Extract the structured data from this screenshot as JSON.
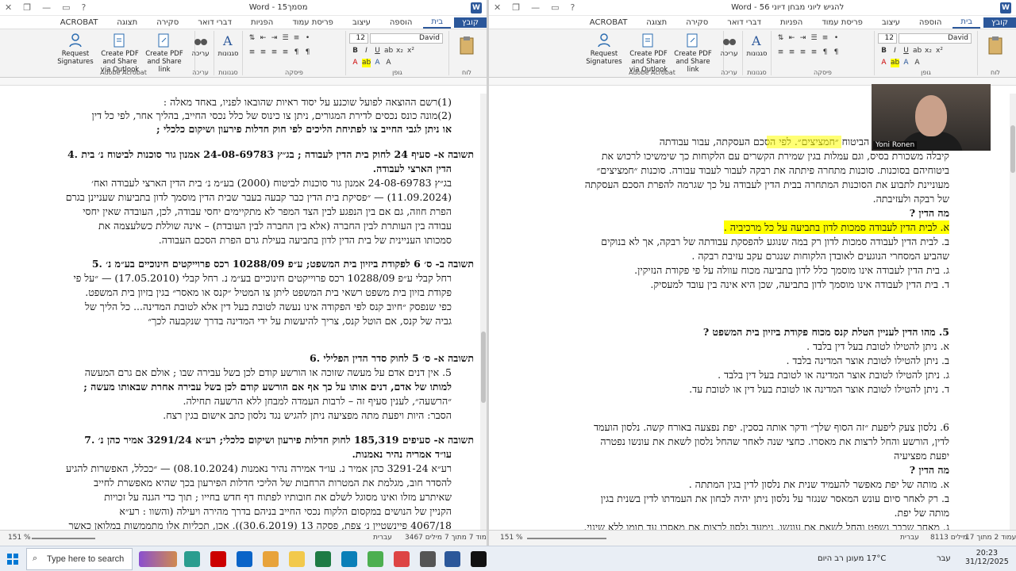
{
  "left_window": {
    "title": "מסמך15 - Word",
    "tabs": [
      "קובץ",
      "בית",
      "הוספה",
      "עיצוב",
      "פריסת עמוד",
      "הפניות",
      "דברי דואר",
      "סקירה",
      "תצוגה",
      "ACROBAT"
    ],
    "ribbon": {
      "acrobat_buttons": [
        "Request Signatures",
        "Create PDF and Share via Outlook",
        "Create PDF and Share link"
      ],
      "group_labels": [
        "Adobe Acrobat",
        "עריכה",
        "סגנונות",
        "פיסקה",
        "גופן",
        "לוח"
      ],
      "style_label": "סגנונות",
      "edit_label": "עריכה",
      "font_name": "David",
      "font_size": "12"
    },
    "body": [
      {
        "text": "(1)רשם ההוצאה לפועל שוכנע על יסוד ראיות שהובאו לפניו, באחד מאלה :",
        "bold": false
      },
      {
        "text": "(2)מונה כונס נכסים לדירת המגורים, ניתן צו כינוס של כלל נכסי החייב, בהליך אחר, לפי כל דין",
        "bold": false
      },
      {
        "text": "או ניתן לגבי החייב צו לפתיחת הליכים לפי חוק חדלות פירעון ושיקום כלכלי ;",
        "bold": true
      },
      {
        "text": "",
        "bold": false
      },
      {
        "text": "תשובה א- סעיף 24 לחוק בית הדין לעבודה ; בג״ץ 24-08-69783 אמנון גור סוכנות לביטוח נ׳ בית  .4",
        "bold": true
      },
      {
        "text": "הדין הארצי לעבודה.",
        "bold": true
      },
      {
        "text": "בג״ץ 24-08-69783 אמנון גור סוכנות לביטוח (2000) בע״מ נ׳ בית הדין הארצי לעבודה ואח׳",
        "bold": false
      },
      {
        "text": "(11.09.2024) — ״פסיקת בית הדין כבר קבעה בעבר שבית הדין מוסמך לדון בתביעות שעניינן בגרם",
        "bold": false
      },
      {
        "text": "הפרת חוזה, גם אם בין הנפגע לבין הצד המפר לא מתקיימים יחסי עבודה, לכן, העובדה שאין יחסי",
        "bold": false
      },
      {
        "text": "עבודה בין העותרת לבין החברה (אלא בין החברה לבין העובדת) – אינה שוללת כשלעצמה את",
        "bold": false
      },
      {
        "text": "סמכותו העניינית של בית הדין לדון בתביעה בעילת גרם הפרת הסכם העבודה.",
        "bold": false
      },
      {
        "text": "",
        "bold": false
      },
      {
        "text": "תשובה ב- ס׳ 6 לפקודת ביזיון בית המשפט; ע״פ 10288/09 רכס פרוייקטים חינוכיים בע״מ נ׳  .5",
        "bold": true
      },
      {
        "text": "רחל קבלי ע״פ 10288/09 רכס פרוייקטים חינוכיים בע״מ נ. רחל קבלי (17.05.2010) — ״על פי",
        "bold": false
      },
      {
        "text": "פקודת בזיון בית משפט רשאי בית המשפט ליתן צו המטיל ״קנס או מאסר״ בגין בזיון בית המשפט.",
        "bold": false
      },
      {
        "text": "כפי שנפסק ״חיוב קנס לפי הפקודה אינו נעשה לטובת בעל דין אלא לטובת המדינה... כל הליך של",
        "bold": false
      },
      {
        "text": "גביה של קנס, אם הוטל קנס, צריך להיעשות על ידי המדינה בדרך שנקבעה לכך״",
        "bold": false
      },
      {
        "text": "",
        "bold": false
      },
      {
        "text": "תשובה א- ס׳ 5 לחוק סדר הדין הפלילי  .6",
        "bold": true
      },
      {
        "text": "5. אין דנים אדם על מעשה שזוכה או הורשע קודם לכן בשל עבירה שבו ; אולם אם גרם המעשה",
        "bold": false
      },
      {
        "text": "למותו של אדם, דנים אותו על כך אף אם הורשע קודם לכן בשל עבירה אחרת שבאותו מעשה ;",
        "bold": true
      },
      {
        "text": "״הרשעה״, לענין סעיף זה – לרבות העמדה למבחן ללא הרשעה תחילה.",
        "bold": false
      },
      {
        "text": "הסבר: היות ויפעת מתה מפציעה ניתן להגיש נגד נלסון כתב אישום בגין רצח.",
        "bold": false
      },
      {
        "text": "",
        "bold": false
      },
      {
        "text": "תשובה א- סעיפים 185,319 לחוק חדלות פירעון ושיקום כלכלי; רע״א 3291/24 אמיר כהן נ׳  .7",
        "bold": true
      },
      {
        "text": "עו״ד אמריה נהיר נאמנות.",
        "bold": true
      },
      {
        "text": "רע״א 3291-24 כהן אמיר נ. עו״ד אמירה נהיר נאמנות (08.10.2024) — ״ככלל, האפשרות להגיע",
        "bold": false
      },
      {
        "text": "להסדר חוב, מגלמת את המטרות הרחבות של הליכי חדלות הפירעון בכך שהיא מאפשרת לחייב",
        "bold": false
      },
      {
        "text": "שאיתרע מזלו ואינו מסוגל לשלם את חובותיו לפתוח דף חדש בחייו ; תוך כדי הגנה על זכויות",
        "bold": false
      },
      {
        "text": "הקניין של הנושים במקסום הלקוח נכסי החייב בניהם בדרך מהירה ויעילה (והשוו : רע״א",
        "bold": false
      },
      {
        "text": "4067/18 פיינשטיין נ׳ צפת, פסקה 13 (30.6.2019)). אכן, תכליות אלו מתממשות במלואן כאשר",
        "bold": false
      }
    ],
    "status": {
      "page": "עמוד 7 מתוך 7",
      "words": "3467 מילים",
      "language": "עברית",
      "zoom": "151 %"
    }
  },
  "right_window": {
    "title": "להגיש ליוני מבחן דיוני 56 - Word",
    "tabs": [
      "קובץ",
      "בית",
      "הוספה",
      "עיצוב",
      "פריסת עמוד",
      "הפניות",
      "דברי דואר",
      "סקירה",
      "תצוגה",
      "ACROBAT"
    ],
    "ribbon": {
      "acrobat_buttons": [
        "Request Signatures",
        "Create PDF and Share via Outlook",
        "Create PDF and Share link"
      ],
      "group_labels": [
        "Adobe Acrobat",
        "עריכה",
        "סגנונות",
        "פיסקה",
        "גופן",
        "לוח"
      ],
      "style_label": "סגנונות",
      "edit_label": "עריכה",
      "font_name": "David",
      "font_size": "12"
    },
    "body_top": [
      "תיק לקוחות בסוכנות הביטוח ״חמציצים״. לפי הסכם העסקתה, עבור עבודתה",
      "קיבלה משכורת בסיס, וגם עמלות בגין שמירת הקשרים עם הלקוחות כך שימשיכו לרכוש את",
      "ביטוחיהם בסוכנות. סוכנות מתחרה פיתתה את רבקה לעבור לעבוד עבורה. סוכנות ״חמציצים״",
      "מעוניינת לתבוע את הסוכנות המתחרה בבית הדין לעבודה על כך שגרמה להפרת הסכם העסקתה",
      "של רבקה ולעזיבתה."
    ],
    "highlight_phrase": "הסכם העסקתה",
    "q_label": "מה הדין ?",
    "answers_a": [
      "א. לבית הדין לעבודה סמכות לדון בתביעה על כל מרכיביה .",
      "ב. לבית הדין לעבודה סמכות לדון רק במה שנוגע להפסקת עבודתה של רבקה, אך לא בנוקים",
      "שהביע המסחרי הנוגעים לאובדן הלקוחות שנגרם עקב עזיבת רבקה .",
      "ג. בית הדין לעבודה אינו מוסמך כלל לדון בתביעה מכוח עוולה על פי פקודת הנזיקין.",
      "ד. בית הדין לעבודה אינו מוסמך לדון בתביעה, שכן היא אינה בין עובד למעסיק."
    ],
    "q5": "5.   מהו הדין לעניין הטלת קנס מכוח פקודת ביזיון בית המשפט ?",
    "answers_5": [
      "א. ניתן להטילו לטובת בעל דין בלבד .",
      "ב. ניתן להטילו לטובת אוצר המדינה בלבד .",
      "ג. ניתן להטילו לטובת אוצר המדינה או לטובת בעל דין בלבד .",
      "ד. ניתן להטילו לטובת אוצר המדינה או לטובת בעל דין או לטובת עד."
    ],
    "q6": [
      "6.   נלסון צעק ליפעת ״זה הסוף שלך״ ודקר אותה בסכין. יפת נפצעה באורח קשה. נלסון הועמד",
      "לדין, הורשע והחל לרצות את מאסרו. כחצי שנה לאחר שהחל נלסון לשאת את עונשו נפטרה",
      "יפעת מפציעיה"
    ],
    "answers_6": [
      "א. מותה של יפת מאפשר להעמיד שנית את נלסון לדין בגין המתתה .",
      "ב. רק לאחר סיום עונש המאסר שנגזר על נלסון ניתן יהיה לבחון את העמדתו לדין בשנית בגין",
      "מותה של יפת.",
      "ג. מאחר שכבר נשפט והחל לשאת את עונשו, נימעד נלסון לרצות את מאסרו עד תומו ללא שינוי."
    ],
    "status": {
      "page": "עמוד 2 מתוך 17",
      "words": "8113 מילים",
      "language": "עברית",
      "zoom": "151 %"
    }
  },
  "webcam": {
    "name": "Yoni Ronen"
  },
  "taskbar": {
    "search_placeholder": "Type here to search",
    "weather": "17°C  מעונן רב היום",
    "language": "עבר",
    "time": "20:23",
    "date": "31/12/2025"
  }
}
